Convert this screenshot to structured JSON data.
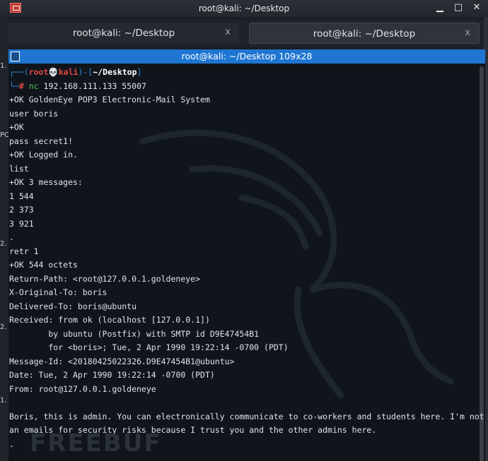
{
  "window": {
    "title": "root@kali: ~/Desktop"
  },
  "tabs": [
    {
      "label": "root@kali: ~/Desktop",
      "close": "x"
    },
    {
      "label": "root@kali: ~/Desktop",
      "close": "x"
    }
  ],
  "terminal": {
    "title": "root@kali: ~/Desktop 109x28",
    "prompt": {
      "user": "root",
      "host": "kali",
      "dir": "~/Desktop",
      "symbol": "#",
      "command_name": "nc",
      "command_args": "192.168.111.133 55007"
    },
    "lines": [
      "+OK GoldenEye POP3 Electronic-Mail System",
      "user boris",
      "+OK",
      "pass secret1!",
      "+OK Logged in.",
      "list",
      "+OK 3 messages:",
      "1 544",
      "2 373",
      "3 921",
      ".",
      "retr 1",
      "+OK 544 octets",
      "Return-Path: <root@127.0.0.1.goldeneye>",
      "X-Original-To: boris",
      "Delivered-To: boris@ubuntu",
      "Received: from ok (localhost [127.0.0.1])",
      "        by ubuntu (Postfix) with SMTP id D9E47454B1",
      "        for <boris>; Tue, 2 Apr 1990 19:22:14 -0700 (PDT)",
      "Message-Id: <20180425022326.D9E47454B1@ubuntu>",
      "Date: Tue, 2 Apr 1990 19:22:14 -0700 (PDT)",
      "From: root@127.0.0.1.goldeneye",
      "",
      "Boris, this is admin. You can electronically communicate to co-workers and students here. I'm not going to sc",
      "an emails for security risks because I trust you and the other admins here.",
      "."
    ]
  },
  "desktop": {
    "side_labels": [
      "1.",
      "PC",
      "2.",
      "2.",
      "1."
    ]
  },
  "watermark": "FREEBUF"
}
